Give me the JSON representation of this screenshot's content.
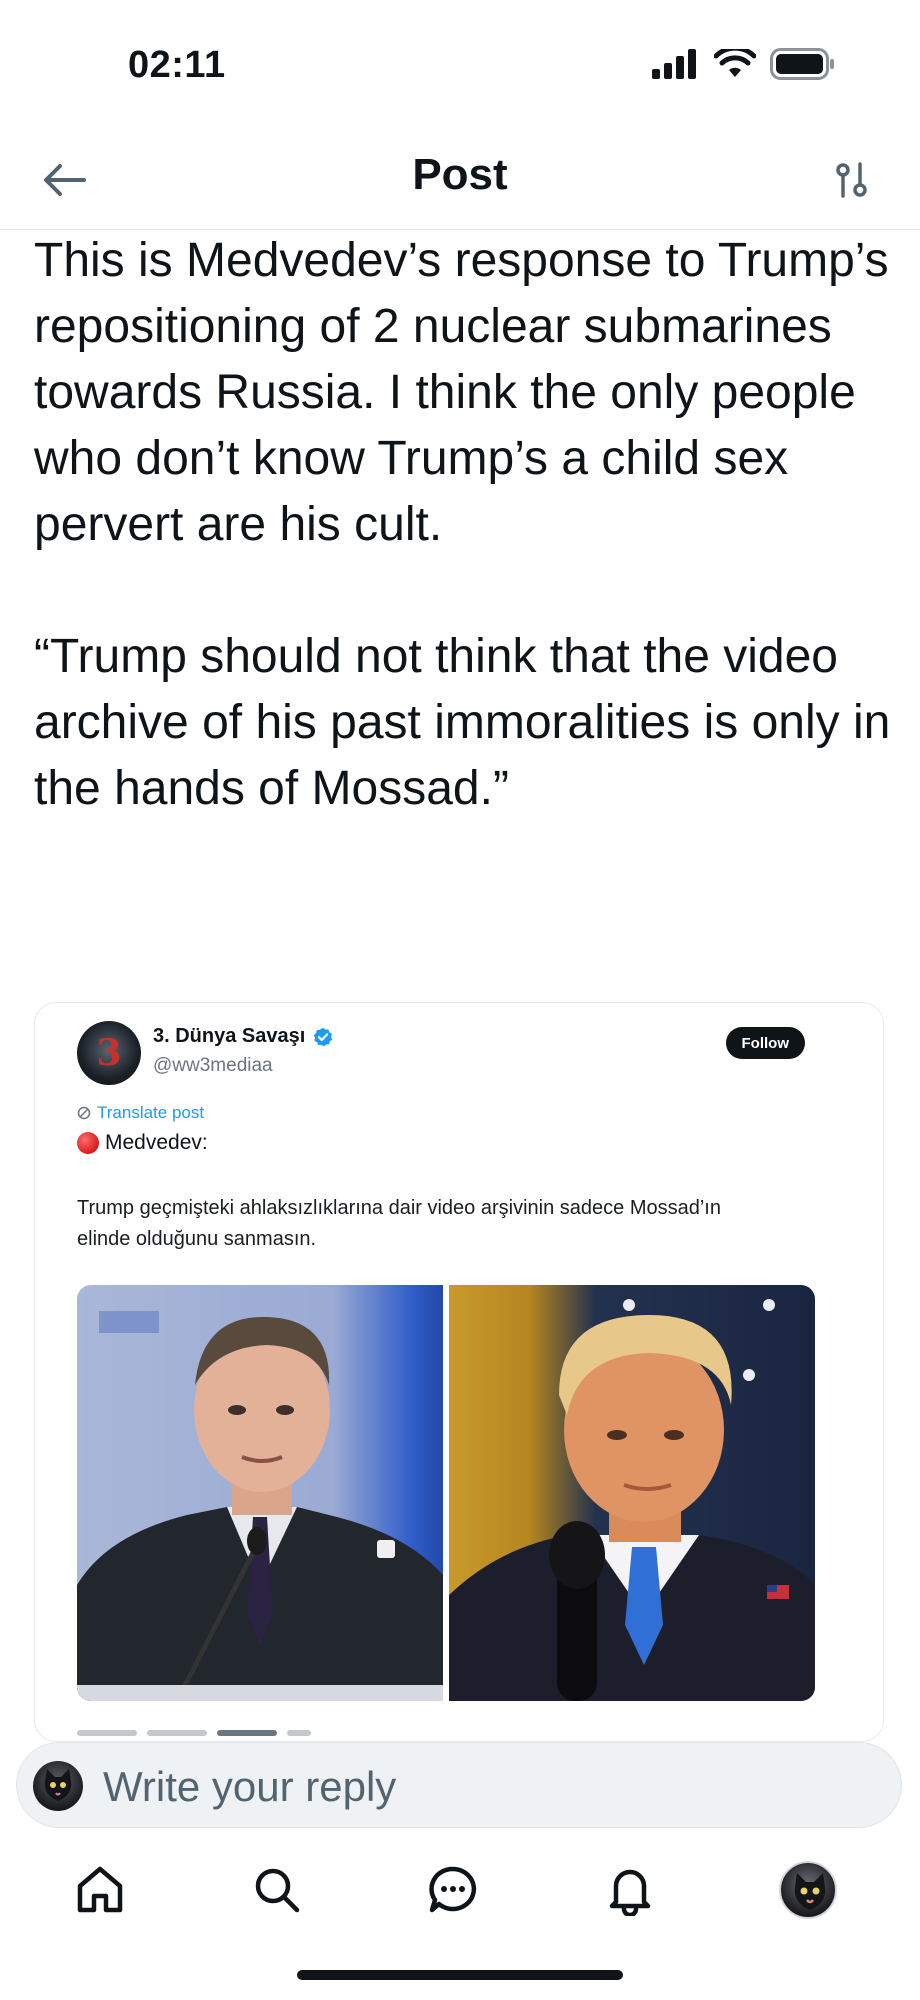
{
  "status_bar": {
    "time": "02:11"
  },
  "header": {
    "title": "Post"
  },
  "post": {
    "text": "This is Medvedev’s response to Trump’s repositioning of 2 nuclear submarines towards Russia. I think the only people who don’t know Trump’s a child sex pervert are his cult.\n\n“Trump should not think that the video archive of his past immoralities is only in the hands of Mossad.”"
  },
  "embed": {
    "avatar_text": "3",
    "author_name": "3. Dünya Savaşı",
    "author_handle": "@ww3mediaa",
    "follow_label": "Follow",
    "translate_label": "Translate post",
    "lead": "Medvedev:",
    "body": "Trump geçmişteki ahlaksızlıklarına dair video arşivinin sadece Mossad’ın elinde olduğunu sanmasın."
  },
  "reply": {
    "placeholder": "Write your reply"
  },
  "colors": {
    "accent": "#1d9bf0",
    "text": "#0f1419",
    "muted": "#536471"
  },
  "icons": {
    "back": "arrow-left-icon",
    "filter": "filter-settings-icon",
    "verified": "verified-badge-icon",
    "translate": "translate-icon",
    "home": "home-icon",
    "search": "search-icon",
    "messages": "messages-icon",
    "notifications": "bell-icon"
  }
}
